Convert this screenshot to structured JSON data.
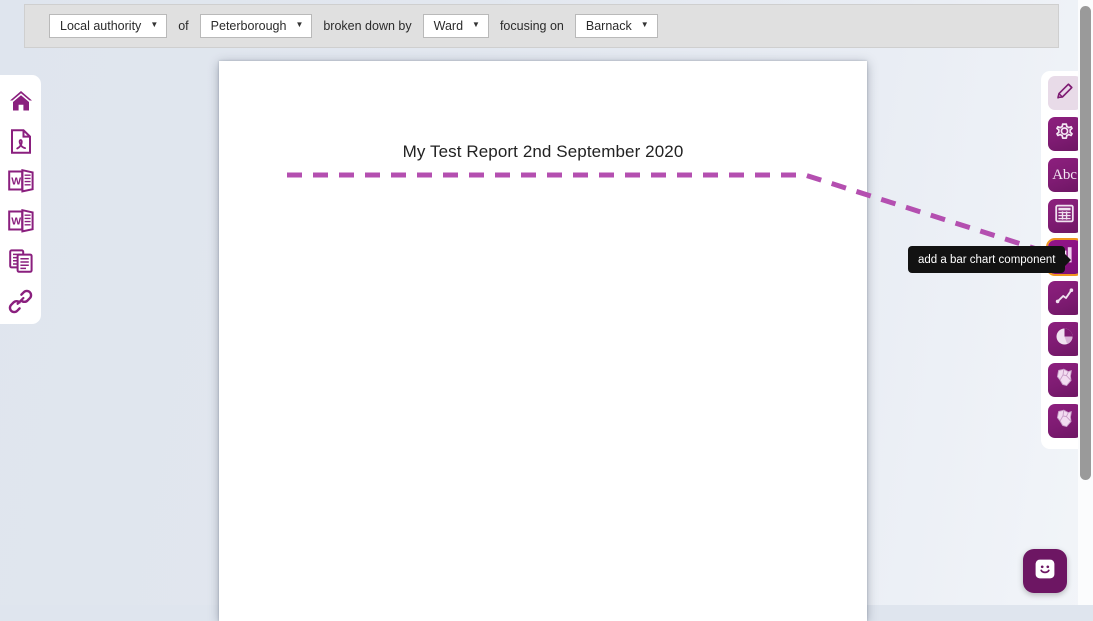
{
  "toolbar": {
    "geography_type": "Local authority",
    "geography_type_caret": "▼",
    "connector_of": "of",
    "area": "Peterborough",
    "area_caret": "▼",
    "connector_broken_down_by": "broken down by",
    "breakdown": "Ward",
    "breakdown_caret": "▼",
    "connector_focusing_on": "focusing on",
    "focus": "Barnack",
    "focus_caret": "▼"
  },
  "left_rail": {
    "items": [
      {
        "name": "home-icon",
        "label": "Home"
      },
      {
        "name": "pdf-export-icon",
        "label": "Export as PDF"
      },
      {
        "name": "word-export-icon",
        "label": "Export as Word"
      },
      {
        "name": "word-export-alt-icon",
        "label": "Export as Word"
      },
      {
        "name": "copy-icon",
        "label": "Copy report"
      },
      {
        "name": "link-icon",
        "label": "Share link"
      }
    ]
  },
  "report": {
    "title": "My Test Report 2nd September 2020"
  },
  "right_rail": {
    "items": [
      {
        "name": "edit-pencil-icon",
        "label": "edit"
      },
      {
        "name": "settings-gear-icon",
        "label": "settings"
      },
      {
        "name": "text-abc-icon",
        "label": "Abc"
      },
      {
        "name": "table-icon",
        "label": "table"
      },
      {
        "name": "bar-chart-icon",
        "label": "bar chart"
      },
      {
        "name": "line-chart-icon",
        "label": "line chart"
      },
      {
        "name": "pie-chart-icon",
        "label": "pie chart"
      },
      {
        "name": "map-icon",
        "label": "map"
      },
      {
        "name": "map-alt-icon",
        "label": "map"
      }
    ],
    "selected_index": 4
  },
  "tooltip": {
    "text": "add a bar chart component"
  },
  "chat": {
    "icon": "smiley-face-icon",
    "label": "Help and support"
  },
  "colors": {
    "brand_purple": "#7e1b72",
    "accent_magenta": "#b44fb0",
    "selection_orange": "#f0951e",
    "toolbar_grey": "#e0e0e0",
    "canvas_blue": "#dfe5ee"
  }
}
